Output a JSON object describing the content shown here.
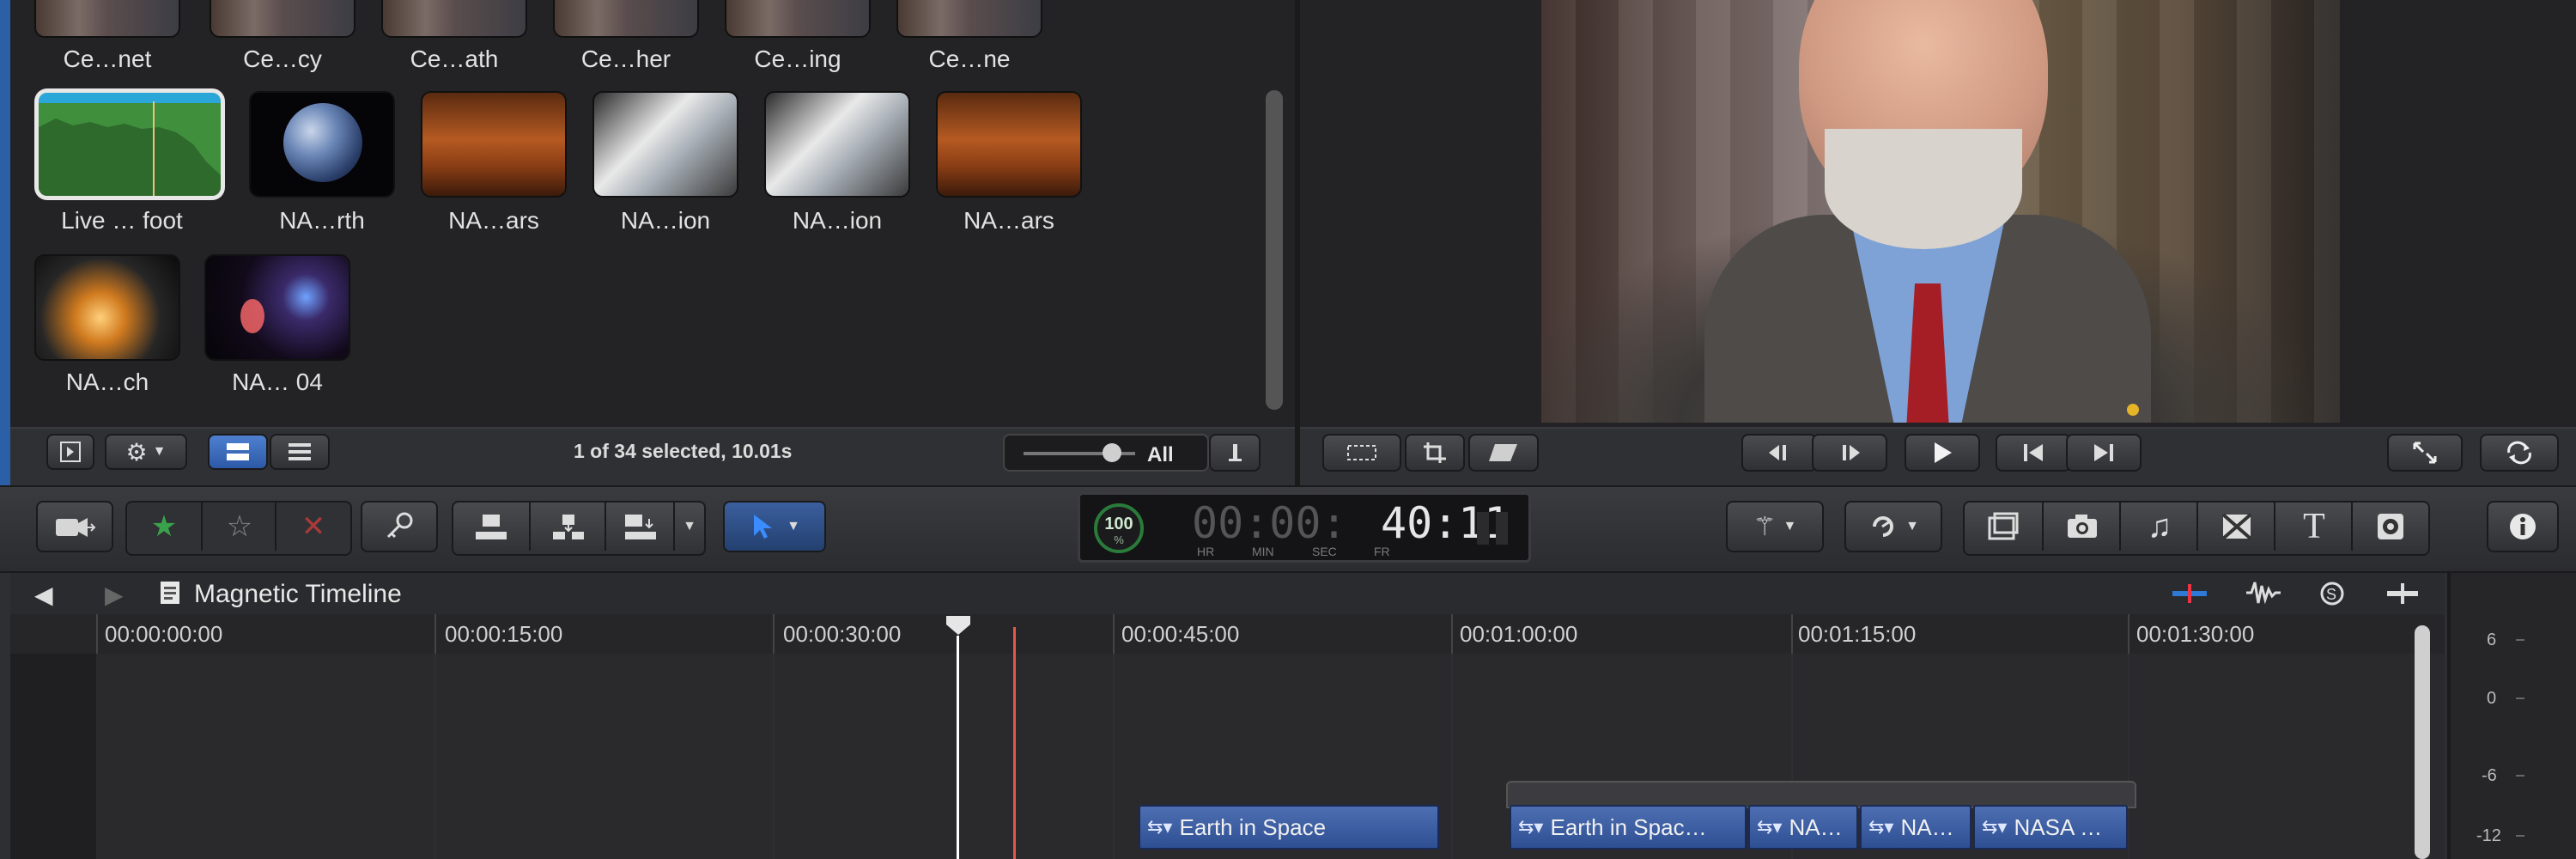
{
  "browser": {
    "row1_labels": [
      "Ce…net",
      "Ce…cy",
      "Ce…ath",
      "Ce…her",
      "Ce…ing",
      "Ce…ne"
    ],
    "row2_labels": [
      "Live … foot",
      "NA…rth",
      "NA…ars",
      "NA…ion",
      "NA…ion",
      "NA…ars"
    ],
    "row3_labels": [
      "NA…ch",
      "NA… 04"
    ],
    "selection_status": "1 of 34 selected, 10.01s",
    "zoom_all": "All"
  },
  "toolbar": {
    "progress_pct": "100",
    "progress_unit": "%",
    "timecode": {
      "dim": "00:00:",
      "bright": "40:11",
      "labels": [
        "HR",
        "MIN",
        "SEC",
        "FR"
      ]
    }
  },
  "timeline": {
    "title": "Magnetic Timeline",
    "ruler": [
      "00:00:00:00",
      "00:00:15:00",
      "00:00:30:00",
      "00:00:45:00",
      "00:01:00:00",
      "00:01:15:00",
      "00:01:30:00"
    ],
    "clips": [
      "Earth in Space",
      "Earth in Spac…",
      "NA…",
      "NA…",
      "NASA …"
    ]
  },
  "meter": {
    "levels": [
      "6",
      "0",
      "-6",
      "-12"
    ]
  },
  "colors": {
    "accent_blue": "#2b5fa6",
    "clip_blue": "#3b5ea3",
    "playhead": "#e05a46",
    "skimmer": "#ffffff"
  },
  "icons": [
    "import-icon",
    "star-icon",
    "reject-icon",
    "key-icon",
    "connect-clip-icon",
    "insert-clip-icon",
    "append-clip-icon",
    "select-tool-icon",
    "magic-wand-icon",
    "retime-icon",
    "effects-icon",
    "photo-icon",
    "music-icon",
    "transition-icon",
    "title-icon",
    "generator-icon",
    "theme-icon",
    "inspector-icon"
  ]
}
